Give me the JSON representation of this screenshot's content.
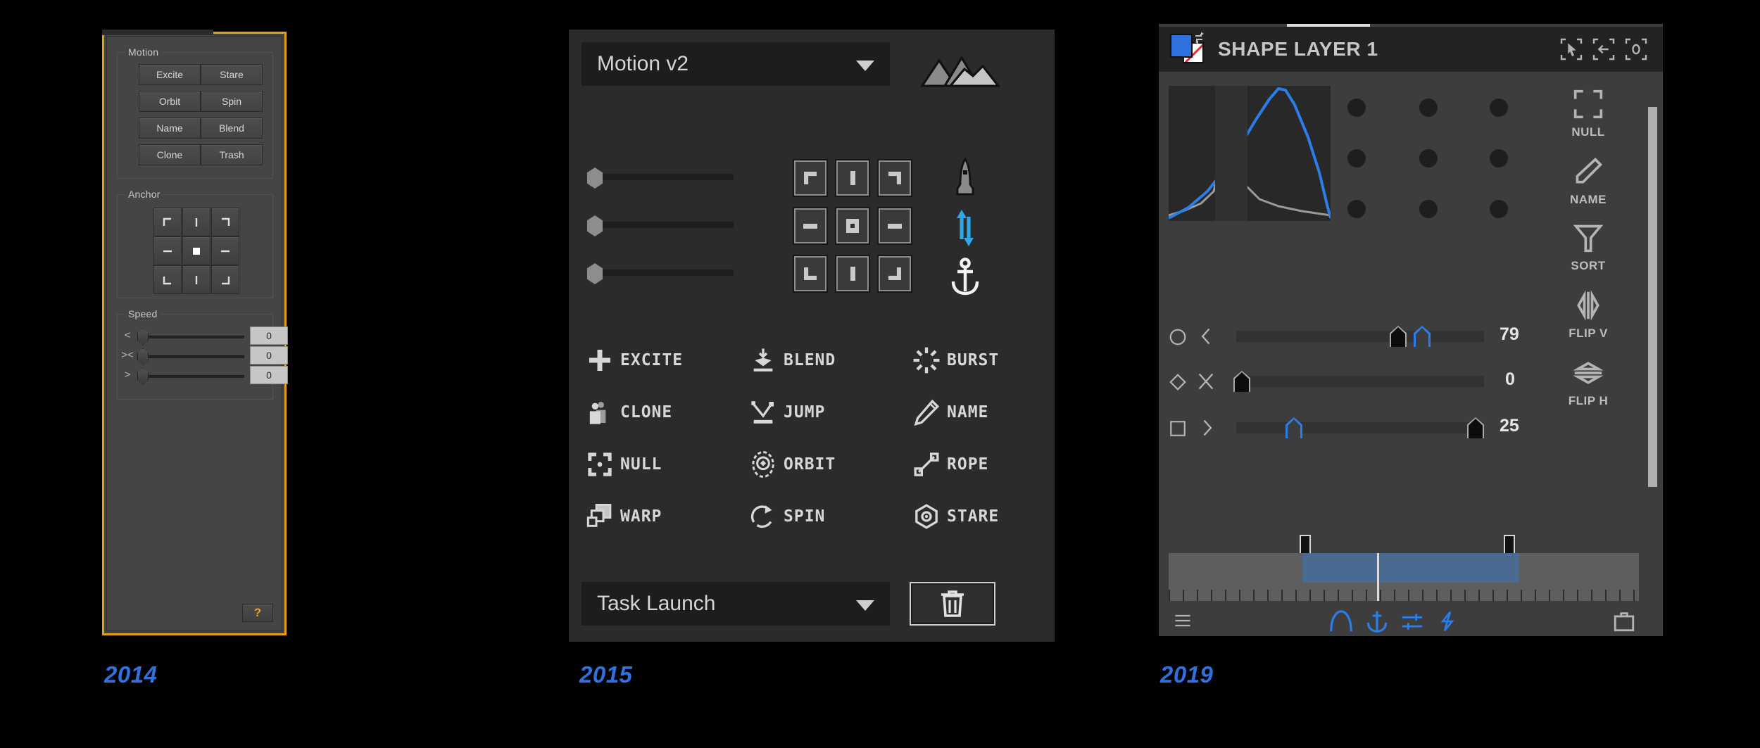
{
  "colors": {
    "accent_blue": "#2f72df",
    "panel2014_border": "#e2a013",
    "help_orange": "#f0a018",
    "ui_blue": "#2b7de9",
    "curve_blue": "#2b7de9",
    "curve_gray": "#9a9a9a"
  },
  "panel_2014": {
    "year": "2014",
    "groups": {
      "motion": {
        "title": "Motion",
        "buttons": [
          "Excite",
          "Stare",
          "Orbit",
          "Spin",
          "Name",
          "Blend",
          "Clone",
          "Trash"
        ]
      },
      "anchor": {
        "title": "Anchor",
        "cells": [
          "anchor-top-left",
          "anchor-top-center",
          "anchor-top-right",
          "anchor-middle-left",
          "anchor-center",
          "anchor-middle-right",
          "anchor-bottom-left",
          "anchor-bottom-center",
          "anchor-bottom-right"
        ]
      },
      "speed": {
        "title": "Speed",
        "rows": [
          {
            "label": "<",
            "value": "0"
          },
          {
            "label": "><",
            "value": "0"
          },
          {
            "label": ">",
            "value": "0"
          }
        ]
      }
    },
    "help_label": "?"
  },
  "panel_2015": {
    "year": "2015",
    "title": "Motion v2",
    "title_caret": "chevron-down-icon",
    "logo": "mountains-icon",
    "sliders": [
      {
        "name": "slider-1",
        "value": 0
      },
      {
        "name": "slider-2",
        "value": 0
      },
      {
        "name": "slider-3",
        "value": 0
      }
    ],
    "anchor_cells": [
      "anchor-top-left",
      "anchor-top-center",
      "anchor-top-right",
      "anchor-middle-left",
      "anchor-center",
      "anchor-middle-right",
      "anchor-bottom-left",
      "anchor-bottom-center",
      "anchor-bottom-right"
    ],
    "side_icons": [
      "rocket-icon",
      "flip-vertical-icon",
      "anchor-icon"
    ],
    "tools": [
      {
        "label": "EXCITE",
        "icon": "plus-icon"
      },
      {
        "label": "BLEND",
        "icon": "blend-icon"
      },
      {
        "label": "BURST",
        "icon": "burst-icon"
      },
      {
        "label": "CLONE",
        "icon": "clone-icon"
      },
      {
        "label": "JUMP",
        "icon": "jump-icon"
      },
      {
        "label": "NAME",
        "icon": "pencil-icon"
      },
      {
        "label": "NULL",
        "icon": "null-icon"
      },
      {
        "label": "ORBIT",
        "icon": "orbit-icon"
      },
      {
        "label": "ROPE",
        "icon": "rope-icon"
      },
      {
        "label": "WARP",
        "icon": "warp-icon"
      },
      {
        "label": "SPIN",
        "icon": "spin-icon"
      },
      {
        "label": "STARE",
        "icon": "stare-icon"
      }
    ],
    "task_launch": "Task Launch",
    "task_caret": "chevron-down-icon",
    "trash": "trash-icon"
  },
  "panel_2019": {
    "year": "2019",
    "title": "SHAPE LAYER 1",
    "swatch": {
      "fill": "#2f72df",
      "stroke": "none-red-slash"
    },
    "header_icons": [
      "cursor-select-icon",
      "arrow-left-icon",
      "zero-icon"
    ],
    "sliders": [
      {
        "shape_icon": "circle-icon",
        "dir_icon": "chevron-left-icon",
        "value": "79"
      },
      {
        "shape_icon": "diamond-icon",
        "dir_icon": "x-icon",
        "value": "0"
      },
      {
        "shape_icon": "square-icon",
        "dir_icon": "chevron-right-icon",
        "value": "25"
      }
    ],
    "right_tools": [
      {
        "label": "NULL",
        "icon": "null-icon"
      },
      {
        "label": "NAME",
        "icon": "pencil-icon"
      },
      {
        "label": "SORT",
        "icon": "funnel-icon"
      },
      {
        "label": "FLIP V",
        "icon": "flip-vertical-icon"
      },
      {
        "label": "FLIP H",
        "icon": "flip-horizontal-icon"
      }
    ],
    "bottom_icons": [
      "menu-icon",
      "curve-icon",
      "anchor-icon",
      "sliders-icon",
      "bolt-icon",
      "briefcase-icon"
    ]
  },
  "chart_data": {
    "type": "line",
    "title": "",
    "xlabel": "",
    "ylabel": "",
    "xlim": [
      0,
      1
    ],
    "ylim": [
      0,
      1
    ],
    "grid": false,
    "legend": "none",
    "series": [
      {
        "name": "gray-curve",
        "color": "#9a9a9a",
        "x": [
          0.0,
          0.1,
          0.2,
          0.28,
          0.33,
          0.36,
          0.38,
          0.4,
          0.43,
          0.48,
          0.56,
          0.68,
          0.82,
          1.0
        ],
        "y": [
          0.04,
          0.07,
          0.13,
          0.26,
          0.48,
          0.78,
          0.97,
          0.8,
          0.46,
          0.26,
          0.16,
          0.11,
          0.07,
          0.04
        ]
      },
      {
        "name": "blue-curve",
        "color": "#2b7de9",
        "x": [
          0.0,
          0.12,
          0.24,
          0.34,
          0.44,
          0.54,
          0.62,
          0.68,
          0.72,
          0.78,
          0.86,
          0.93,
          0.98,
          1.0
        ],
        "y": [
          0.02,
          0.1,
          0.22,
          0.37,
          0.55,
          0.75,
          0.9,
          0.98,
          0.97,
          0.86,
          0.62,
          0.36,
          0.12,
          0.02
        ]
      }
    ]
  }
}
